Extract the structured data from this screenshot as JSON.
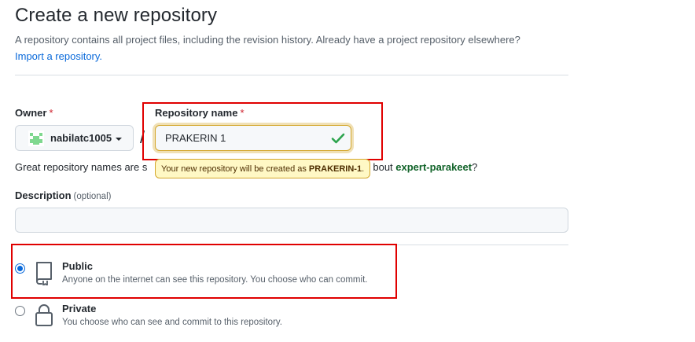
{
  "header": {
    "title": "Create a new repository",
    "subtitle": "A repository contains all project files, including the revision history. Already have a project repository elsewhere?",
    "import_link": "Import a repository."
  },
  "owner": {
    "label": "Owner",
    "required_mark": "*",
    "value": "nabilatc1005"
  },
  "separator": "/",
  "repo_name": {
    "label": "Repository name",
    "required_mark": "*",
    "value": "PRAKERIN 1"
  },
  "hint": {
    "prefix": "Great repository names are s",
    "suffix_pre": "bout ",
    "suggestion": "expert-parakeet",
    "suffix_post": "?"
  },
  "tooltip": {
    "text": "Your new repository will be created as",
    "name": "PRAKERIN-1",
    "period": "."
  },
  "description": {
    "label": "Description",
    "optional": "(optional)",
    "value": ""
  },
  "visibility": {
    "public": {
      "title": "Public",
      "desc": "Anyone on the internet can see this repository. You choose who can commit.",
      "selected": true
    },
    "private": {
      "title": "Private",
      "desc": "You choose who can see and commit to this repository.",
      "selected": false
    }
  },
  "colors": {
    "link": "#0969da",
    "valid": "#2da44e",
    "suggestion": "#116329",
    "annotation": "#e00000",
    "tooltip_bg": "#fff8c5"
  }
}
